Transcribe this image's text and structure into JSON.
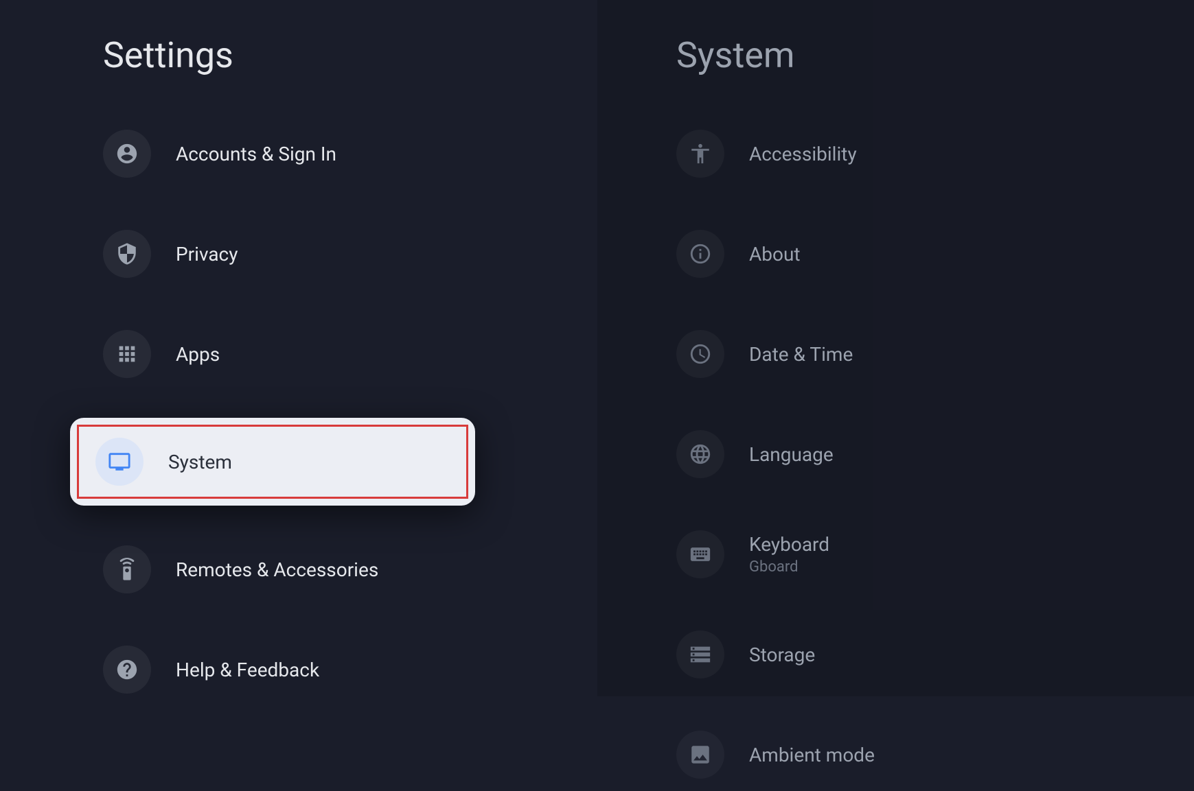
{
  "left": {
    "title": "Settings",
    "items": [
      {
        "label": "Accounts & Sign In",
        "icon": "account"
      },
      {
        "label": "Privacy",
        "icon": "shield"
      },
      {
        "label": "Apps",
        "icon": "apps"
      },
      {
        "label": "System",
        "icon": "tv",
        "selected": true
      },
      {
        "label": "Remotes & Accessories",
        "icon": "remote"
      },
      {
        "label": "Help & Feedback",
        "icon": "help"
      }
    ]
  },
  "right": {
    "title": "System",
    "items": [
      {
        "label": "Accessibility",
        "icon": "accessibility"
      },
      {
        "label": "About",
        "icon": "info"
      },
      {
        "label": "Date & Time",
        "icon": "clock"
      },
      {
        "label": "Language",
        "icon": "globe"
      },
      {
        "label": "Keyboard",
        "sublabel": "Gboard",
        "icon": "keyboard"
      },
      {
        "label": "Storage",
        "icon": "storage"
      },
      {
        "label": "Ambient mode",
        "icon": "photo"
      }
    ]
  }
}
